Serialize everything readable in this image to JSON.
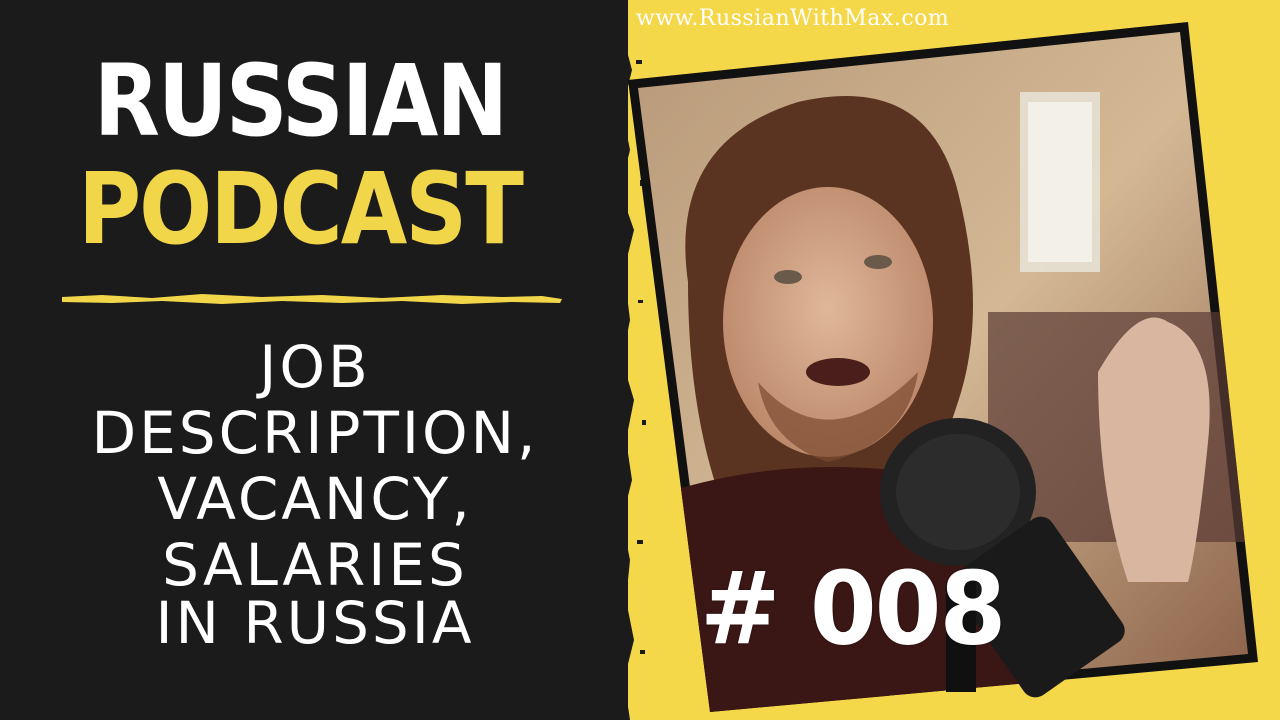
{
  "website": "www.RussianWithMax.com",
  "title": {
    "line1": "RUSSIAN",
    "line2": "PODCAST"
  },
  "topic": {
    "line1": "JOB",
    "line2": "DESCRIPTION,",
    "line3": "VACANCY,",
    "line4": "SALARIES",
    "line5": "IN RUSSIA"
  },
  "episode": "# 008",
  "colors": {
    "background_dark": "#1b1b1b",
    "accent_yellow": "#f2d64a",
    "text_white": "#ffffff"
  },
  "icons": {
    "photo": "podcast-host-photo",
    "microphone": "microphone-icon"
  }
}
